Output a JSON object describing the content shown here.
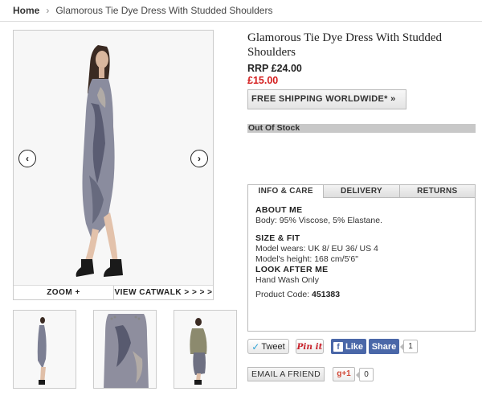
{
  "breadcrumb": {
    "home": "Home",
    "separator": "›",
    "current": "Glamorous Tie Dye Dress With Studded Shoulders"
  },
  "gallery": {
    "prev_icon": "‹",
    "next_icon": "›",
    "zoom_label": "ZOOM +",
    "catwalk_label": "VIEW CATWALK  > > > >"
  },
  "product": {
    "title": "Glamorous Tie Dye Dress With Studded Shoulders",
    "rrp": "RRP £24.00",
    "price": "£15.00",
    "shipping_label": "FREE SHIPPING WORLDWIDE*  »",
    "stock_status": "Out Of Stock"
  },
  "tabs": [
    {
      "label": "INFO & CARE"
    },
    {
      "label": "DELIVERY"
    },
    {
      "label": "RETURNS"
    }
  ],
  "info": {
    "about_head": "ABOUT ME",
    "about_body": "Body: 95% Viscose, 5% Elastane.",
    "size_head": "SIZE & FIT",
    "size_line1": "Model wears: UK 8/ EU 36/ US 4",
    "size_line2": "Model's height: 168 cm/5'6\"",
    "look_head": "LOOK AFTER ME",
    "look_body": "Hand Wash Only",
    "code_label": "Product Code:",
    "code_value": "451383"
  },
  "social": {
    "tweet": "Tweet",
    "pin": "Pin it",
    "like": "Like",
    "share": "Share",
    "fb_count": "1",
    "email": "EMAIL A FRIEND",
    "gplus": "g+1",
    "gplus_count": "0"
  },
  "colors": {
    "sale_price": "#d41d1d",
    "facebook": "#4a67a8",
    "out_of_stock_bar": "#c8c8c8"
  }
}
